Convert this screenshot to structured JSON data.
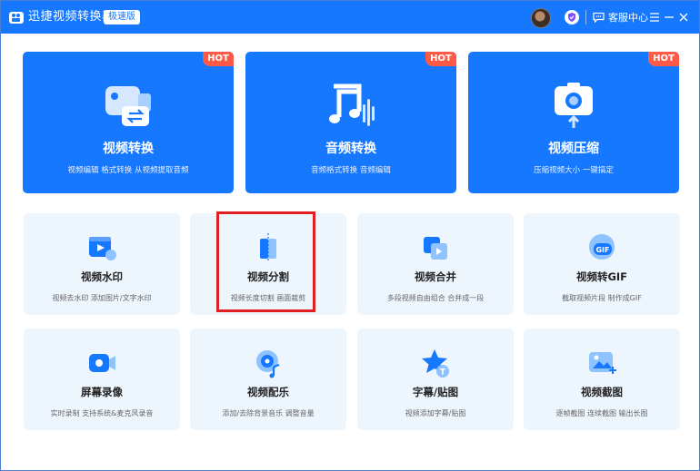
{
  "titlebar": {
    "title": "迅捷视频转换器",
    "edition_badge": "极速版",
    "support_label": "客服中心",
    "icons": [
      "app-logo-icon",
      "avatar",
      "vip-shield-icon",
      "chat-bubble-icon",
      "menu-icon",
      "minimize-icon",
      "close-icon"
    ]
  },
  "top_cards": [
    {
      "title": "视频转换",
      "subtitle": "视频编辑 格式转换 从视频提取音频",
      "badge": "HOT",
      "icon": "video-convert-icon"
    },
    {
      "title": "音频转换",
      "subtitle": "音频格式转换 音频编辑",
      "badge": "HOT",
      "icon": "audio-convert-icon"
    },
    {
      "title": "视频压缩",
      "subtitle": "压缩视频大小 一键搞定",
      "badge": "HOT",
      "icon": "video-compress-icon"
    }
  ],
  "cards": [
    {
      "title": "视频水印",
      "subtitle": "视频去水印 添加图片/文字水印",
      "icon": "watermark-icon"
    },
    {
      "title": "视频分割",
      "subtitle": "视频长度切割 画面裁剪",
      "icon": "split-icon"
    },
    {
      "title": "视频合并",
      "subtitle": "多段视频自由组合 合并成一段",
      "icon": "merge-icon"
    },
    {
      "title": "视频转GIF",
      "subtitle": "截取视频片段 制作成GIF",
      "icon": "gif-icon"
    },
    {
      "title": "屏幕录像",
      "subtitle": "实时录制 支持系统&麦克风录音",
      "icon": "screen-record-icon"
    },
    {
      "title": "视频配乐",
      "subtitle": "添加/去除背景音乐 调整音量",
      "icon": "music-icon"
    },
    {
      "title": "字幕/贴图",
      "subtitle": "视频添加字幕/贴图",
      "icon": "subtitle-sticker-icon"
    },
    {
      "title": "视频截图",
      "subtitle": "逐帧截图 连续截图 输出长图",
      "icon": "screenshot-icon"
    }
  ],
  "colors": {
    "titlebar": "#1677ff",
    "top_card": "#1677ff",
    "card_bg": "#edf5fd",
    "hot_badge": "#ff5a46",
    "highlight": "#e02020"
  }
}
